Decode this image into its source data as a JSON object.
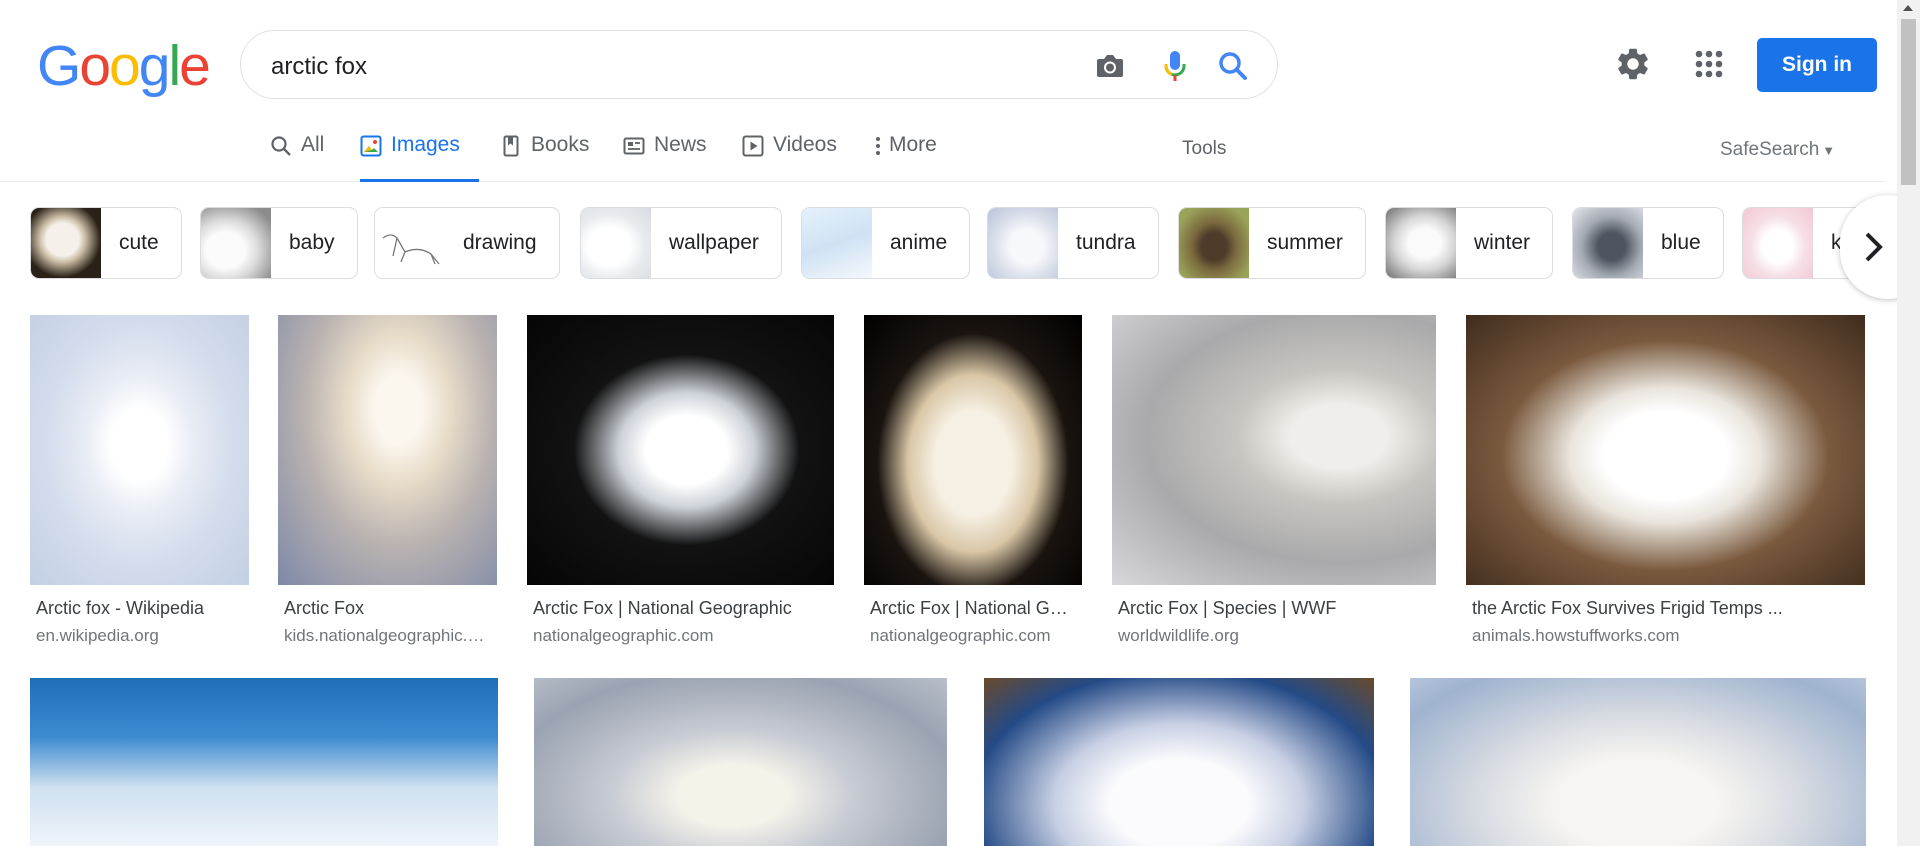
{
  "logo": {
    "letters": [
      "G",
      "o",
      "o",
      "g",
      "l",
      "e"
    ],
    "colors": [
      "#4285F4",
      "#EA4335",
      "#FBBC05",
      "#4285F4",
      "#34A853",
      "#EA4335"
    ]
  },
  "search": {
    "query": "arctic fox",
    "camera_icon": "camera-icon",
    "mic_icon": "mic-icon",
    "search_icon": "search-icon"
  },
  "header": {
    "settings_icon": "gear-icon",
    "apps_icon": "apps-grid-icon",
    "signin_label": "Sign in"
  },
  "tabs": [
    {
      "label": "All",
      "icon": "search-icon"
    },
    {
      "label": "Images",
      "icon": "image-icon",
      "active": true
    },
    {
      "label": "Books",
      "icon": "book-icon"
    },
    {
      "label": "News",
      "icon": "news-icon"
    },
    {
      "label": "Videos",
      "icon": "video-icon"
    },
    {
      "label": "More",
      "icon": "more-vertical-icon"
    }
  ],
  "tools_label": "Tools",
  "safesearch_label": "SafeSearch",
  "chips": [
    {
      "label": "cute"
    },
    {
      "label": "baby"
    },
    {
      "label": "drawing"
    },
    {
      "label": "wallpaper"
    },
    {
      "label": "anime"
    },
    {
      "label": "tundra"
    },
    {
      "label": "summer"
    },
    {
      "label": "winter"
    },
    {
      "label": "blue"
    },
    {
      "label": "k"
    }
  ],
  "results": [
    {
      "title": "Arctic fox - Wikipedia",
      "site": "en.wikipedia.org"
    },
    {
      "title": "Arctic Fox",
      "site": "kids.nationalgeographic.…"
    },
    {
      "title": "Arctic Fox | National Geographic",
      "site": "nationalgeographic.com"
    },
    {
      "title": "Arctic Fox | National G…",
      "site": "nationalgeographic.com"
    },
    {
      "title": "Arctic Fox | Species | WWF",
      "site": "worldwildlife.org"
    },
    {
      "title": "the Arctic Fox Survives Frigid Temps ...",
      "site": "animals.howstuffworks.com"
    }
  ],
  "colors": {
    "accent": "#1a73e8",
    "text_muted": "#5f6368",
    "border": "#dfe1e5"
  }
}
